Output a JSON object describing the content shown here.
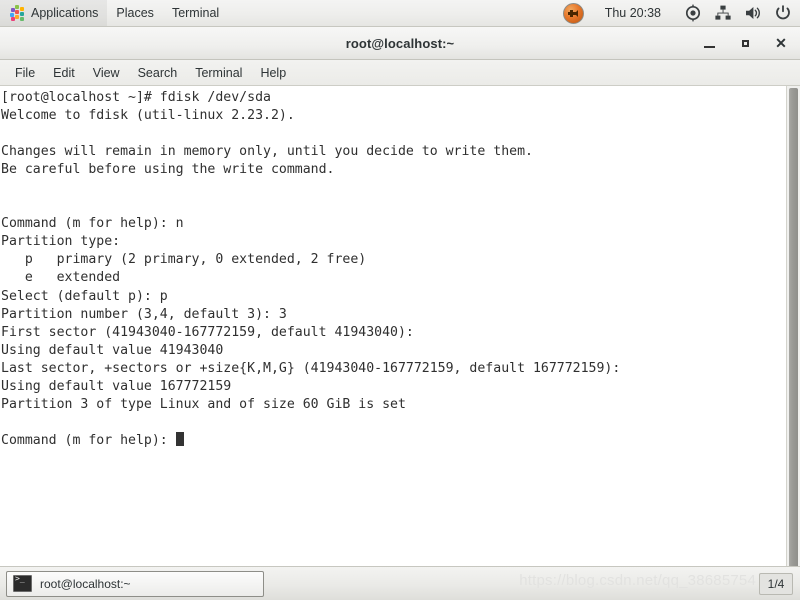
{
  "top_panel": {
    "apps_label": "Applications",
    "places_label": "Places",
    "terminal_label": "Terminal",
    "clock": "Thu 20:38",
    "icons": {
      "apps": "applications-pinwheel-icon",
      "notification": "notification-orb-icon",
      "location": "location-target-icon",
      "network": "network-tree-icon",
      "volume": "volume-speaker-icon",
      "power": "power-icon"
    }
  },
  "window": {
    "title": "root@localhost:~",
    "controls": {
      "minimize": "—",
      "maximize": "□",
      "close": "✕"
    }
  },
  "menubar": {
    "items": [
      {
        "label": "File"
      },
      {
        "label": "Edit"
      },
      {
        "label": "View"
      },
      {
        "label": "Search"
      },
      {
        "label": "Terminal"
      },
      {
        "label": "Help"
      }
    ]
  },
  "terminal": {
    "lines": [
      "[root@localhost ~]# fdisk /dev/sda",
      "Welcome to fdisk (util-linux 2.23.2).",
      "",
      "Changes will remain in memory only, until you decide to write them.",
      "Be careful before using the write command.",
      "",
      "",
      "Command (m for help): n",
      "Partition type:",
      "   p   primary (2 primary, 0 extended, 2 free)",
      "   e   extended",
      "Select (default p): p",
      "Partition number (3,4, default 3): 3",
      "First sector (41943040-167772159, default 41943040):",
      "Using default value 41943040",
      "Last sector, +sectors or +size{K,M,G} (41943040-167772159, default 167772159):",
      "Using default value 167772159",
      "Partition 3 of type Linux and of size 60 GiB is set",
      ""
    ],
    "prompt_line": "Command (m for help): ",
    "colors": {
      "background": "#ffffff",
      "foreground": "#2f2f2f",
      "cursor": "#333333"
    }
  },
  "taskbar": {
    "window_button_label": "root@localhost:~",
    "workspace_indicator": "1/4",
    "watermark": "https://blog.csdn.net/qq_38685754"
  }
}
